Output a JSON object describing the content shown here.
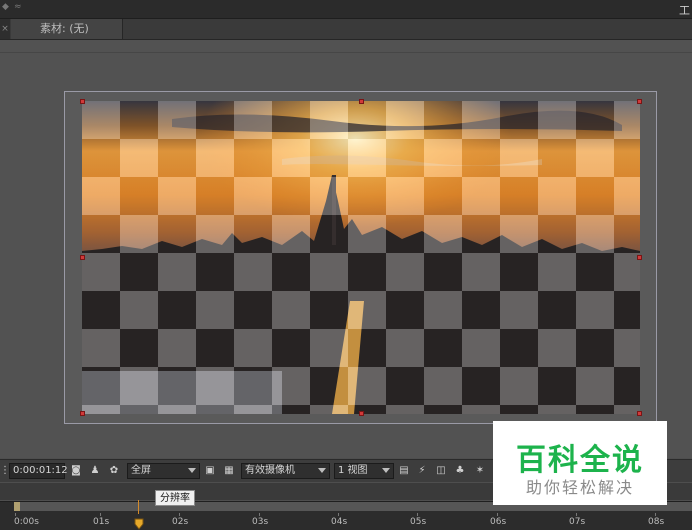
{
  "tabs": {
    "source_tab": "素材: (无)",
    "close_glyph": "×"
  },
  "window": {
    "title_right": "工"
  },
  "toolbar": {
    "timecode": "0:00:01:12",
    "resolution": "全屏",
    "camera": "有效摄像机",
    "view_layout": "1 视图"
  },
  "tooltip": {
    "text": "分辨率"
  },
  "timeline": {
    "ticks": [
      "0:00s",
      "01s",
      "02s",
      "03s",
      "04s",
      "05s",
      "06s",
      "07s",
      "08s"
    ]
  },
  "watermark": {
    "brand": "百科全说",
    "slogan": "助你轻松解决"
  },
  "colors": {
    "accent_playhead": "#d48a2a",
    "handle": "#d13a3a",
    "watermark_green": "#1db34c"
  }
}
